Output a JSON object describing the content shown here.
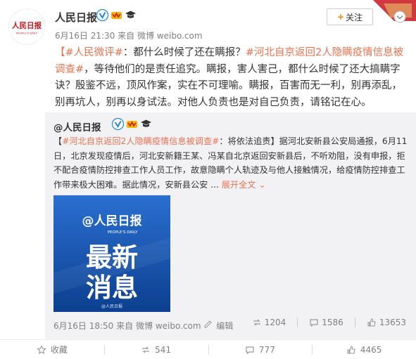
{
  "post": {
    "username": "人民日报",
    "meta_date": "6月16日 21:30",
    "meta_from": "来自",
    "meta_source": "微博 weibo.com",
    "follow_label": "关注",
    "text_tag1": "【#人民微评#",
    "text_part1": "：都什么时候了还在瞒报？",
    "text_tag2": "#河北自京返回2人隐瞒疫情信息被调查#",
    "text_part2": "，等待他们的是责任追究。瞒报，害人害己，都什么时候了还大搞瞒字诀？殷鉴不远，顶风作案，实在不可理喻。瞒报，百害而无一利，别再添乱，别再坑人，别再以身试法。对他人负责也是对自己负责，请铭记在心。",
    "avatar_text": "人民日报",
    "avatar_sub": "PEOPLE'S DAILY"
  },
  "repost": {
    "username": "@人民日报",
    "text_open": "【",
    "text_tag": "#河北自京返回2人隐瞒疫情信息被调查#",
    "text_body": "：将依法追责】据河北安新县公安局通报，6月11日，北京发现疫情后，河北安新籍王某、冯某自北京返回安新县后，不听劝阻，没有申报，拒不配合疫情防控排查工作人员工作，故意隐瞒个人轨迹及与他人接触情况，给疫情防控排查工作带来极大困难。据此情况，安新县公安 ...",
    "expand_label": "展开全文",
    "expand_arrow": "⌄",
    "thumb_logo": "@人民日报",
    "thumb_logo_sub": "PEOPLE'S DAILY",
    "thumb_line1": "最新",
    "thumb_line2": "消息",
    "thumb_watermark": "@人民日报",
    "meta_date": "6月16日 18:50",
    "meta_from": "来自",
    "meta_source": "微博 weibo.com",
    "meta_tail": "编辑",
    "reposts": "1204",
    "comments": "1586",
    "likes": "13653"
  },
  "footer": {
    "favorite_label": "收藏",
    "reposts": "541",
    "comments": "777",
    "likes": "4465"
  },
  "colors": {
    "accent": "#eb7350",
    "follow_plus": "#ff8200",
    "repost_bg": "#f2f2f5",
    "thumb_bg": "#1a5bb8"
  }
}
